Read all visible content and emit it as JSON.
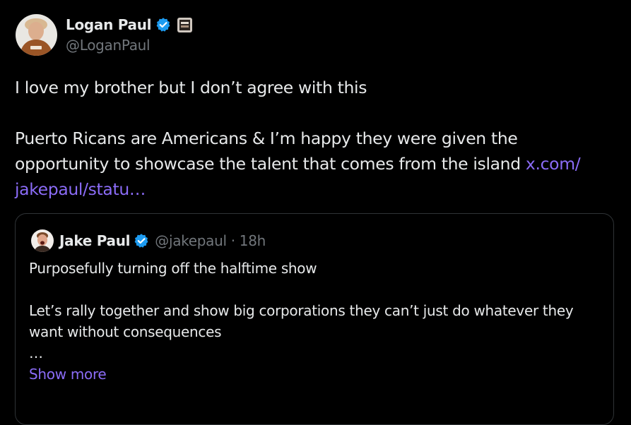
{
  "author": {
    "name": "Logan Paul",
    "handle": "@LoganPaul"
  },
  "tweet": {
    "lines": [
      "I love my brother but I don’t agree with this",
      "Puerto Ricans are Americans & I’m happy they were given the",
      "opportunity to showcase the talent that comes from the island "
    ],
    "link_part1": "x.com/",
    "link_part2": "jakepaul/statu…"
  },
  "quote": {
    "name": "Jake Paul",
    "handle": "@jakepaul",
    "separator": "·",
    "time": "18h",
    "lines": [
      "Purposefully turning off the halftime show",
      "Let’s rally together and show big corporations they can’t just do whatever they",
      "want without consequences",
      "…"
    ],
    "show_more": "Show more"
  },
  "colors": {
    "background": "#000000",
    "text": "#e7e9ea",
    "secondary_text": "#71767b",
    "link": "#8b6cf7",
    "verified": "#1d9bf0",
    "border": "#2f3336"
  },
  "icons": {
    "verified": "verified-badge-icon",
    "affiliate": "affiliate-badge-icon"
  }
}
